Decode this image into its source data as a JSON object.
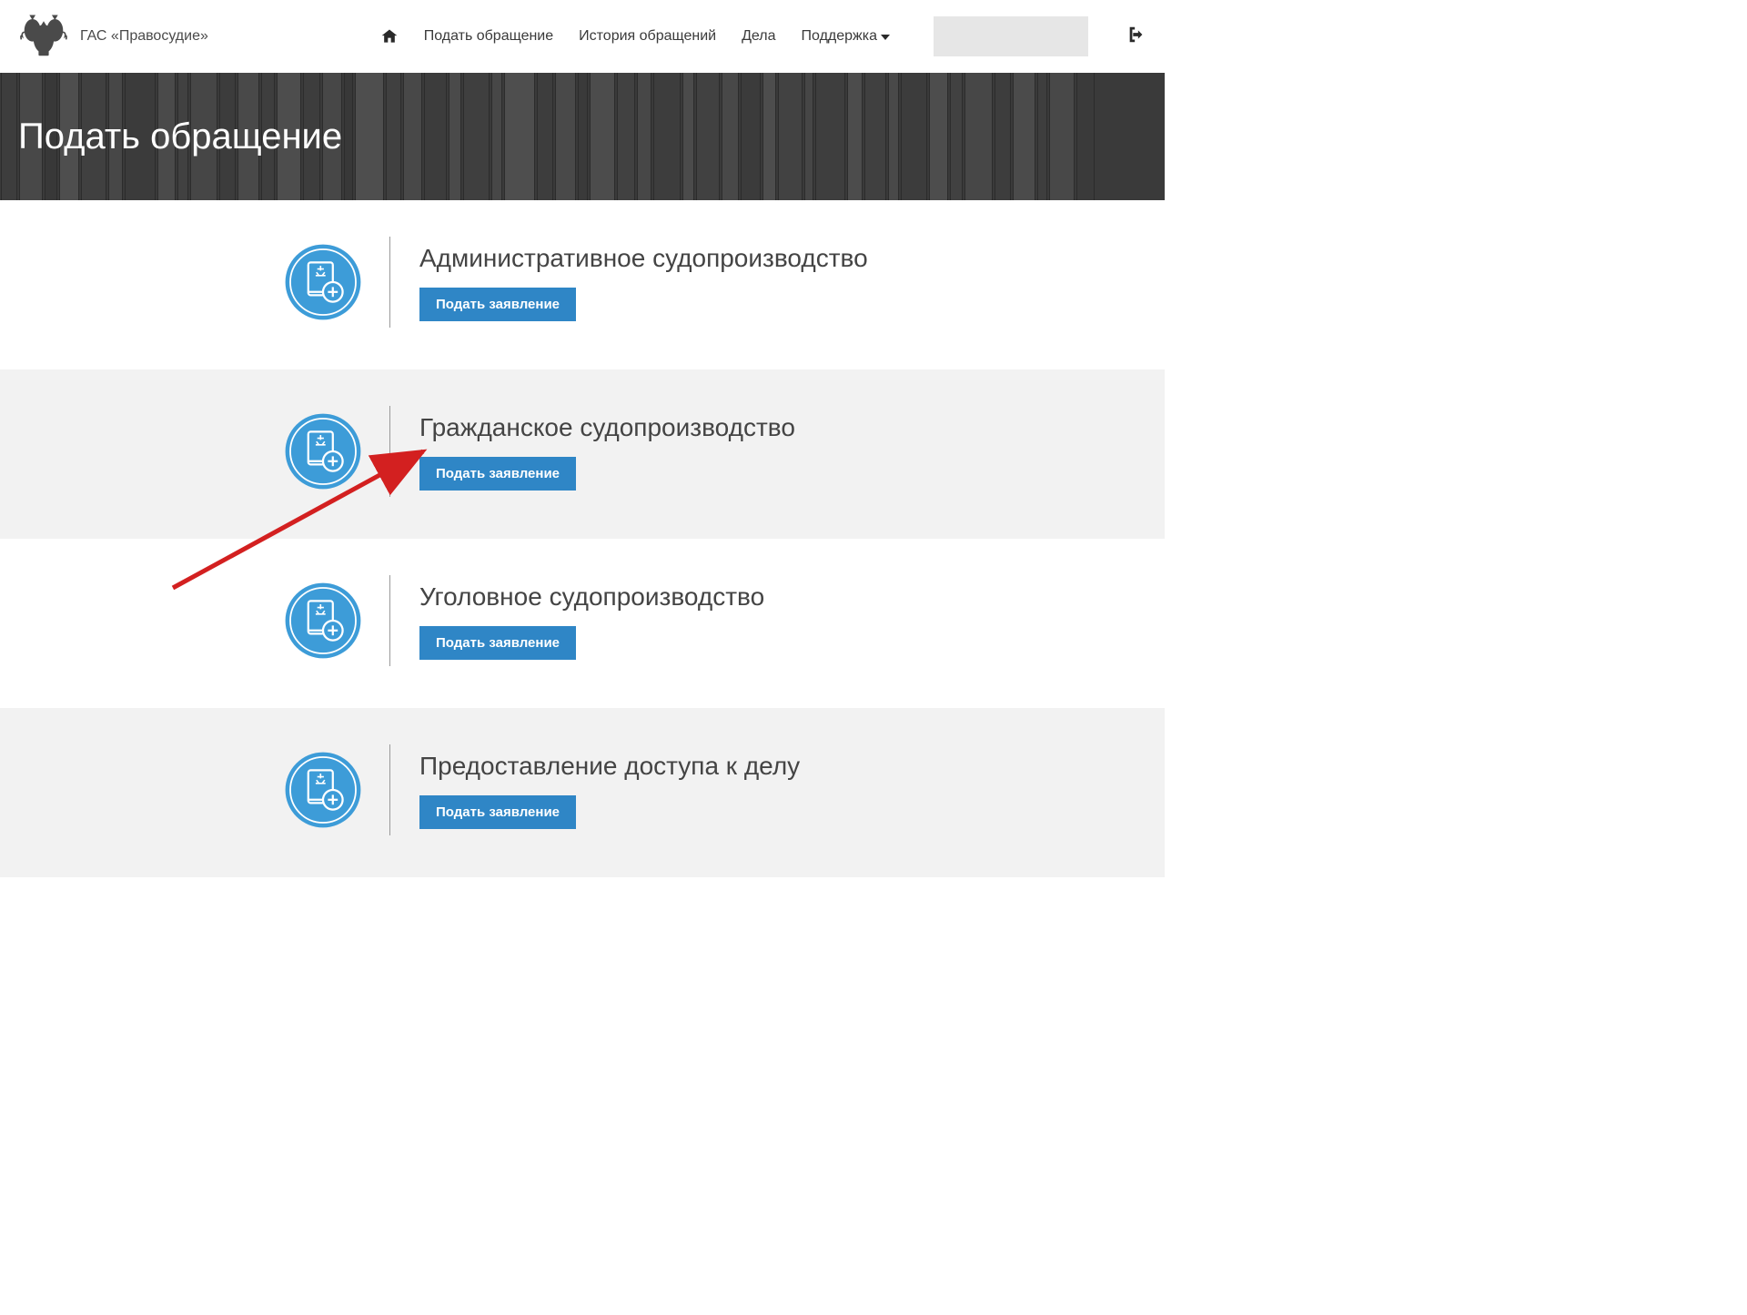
{
  "header": {
    "app_title": "ГАС «Правосудие»",
    "nav": {
      "submit": "Подать обращение",
      "history": "История обращений",
      "cases": "Дела",
      "support": "Поддержка"
    }
  },
  "banner": {
    "title": "Подать обращение"
  },
  "sections": [
    {
      "title": "Административное судопроизводство",
      "button": "Подать заявление"
    },
    {
      "title": "Гражданское судопроизводство",
      "button": "Подать заявление"
    },
    {
      "title": "Уголовное судопроизводство",
      "button": "Подать заявление"
    },
    {
      "title": "Предоставление доступа к делу",
      "button": "Подать заявление"
    }
  ],
  "colors": {
    "accent": "#2f86c6",
    "arrow": "#d32020"
  }
}
